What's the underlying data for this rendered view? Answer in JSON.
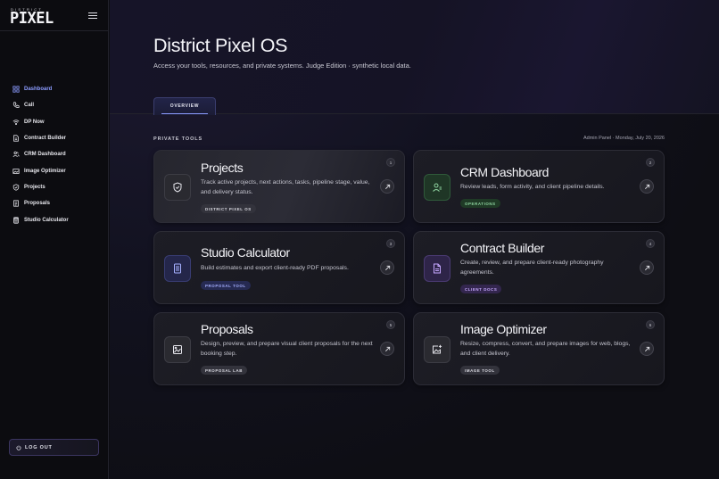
{
  "brand": {
    "small": "DISTRICT",
    "big": "PIXEL"
  },
  "nav": {
    "items": [
      {
        "label": "Dashboard",
        "icon": "grid-icon",
        "active": true
      },
      {
        "label": "Call",
        "icon": "phone-icon"
      },
      {
        "label": "DP Now",
        "icon": "wifi-icon"
      },
      {
        "label": "Contract Builder",
        "icon": "document-icon"
      },
      {
        "label": "CRM Dashboard",
        "icon": "users-icon"
      },
      {
        "label": "Image Optimizer",
        "icon": "image-icon"
      },
      {
        "label": "Projects",
        "icon": "shield-icon"
      },
      {
        "label": "Proposals",
        "icon": "file-text-icon"
      },
      {
        "label": "Studio Calculator",
        "icon": "calculator-icon"
      }
    ]
  },
  "logout_label": "LOG OUT",
  "header": {
    "title": "District Pixel OS",
    "subtitle": "Access your tools, resources, and private systems. Judge Edition · synthetic local data."
  },
  "tabs": [
    {
      "label": "OVERVIEW",
      "active": true
    }
  ],
  "section": {
    "label": "PRIVATE TOOLS",
    "meta": "Admin Panel · Monday, July 20, 2026"
  },
  "cards": [
    {
      "title": "Projects",
      "description": "Track active projects, next actions, tasks, pipeline stage, value, and delivery status.",
      "badge": "DISTRICT PIXEL OS",
      "number": "1",
      "icon": "shield-icon"
    },
    {
      "title": "CRM Dashboard",
      "description": "Review leads, form activity, and client pipeline details.",
      "badge": "OPERATIONS",
      "number": "2",
      "icon": "user-check-icon"
    },
    {
      "title": "Studio Calculator",
      "description": "Build estimates and export client-ready PDF proposals.",
      "badge": "PROPOSAL TOOL",
      "number": "3",
      "icon": "calculator-icon"
    },
    {
      "title": "Contract Builder",
      "description": "Create, review, and prepare client-ready photography agreements.",
      "badge": "CLIENT DOCS",
      "number": "4",
      "icon": "document-icon"
    },
    {
      "title": "Proposals",
      "description": "Design, preview, and prepare visual client proposals for the next booking step.",
      "badge": "PROPOSAL LAB",
      "number": "5",
      "icon": "image-frame-icon"
    },
    {
      "title": "Image Optimizer",
      "description": "Resize, compress, convert, and prepare images for web, blogs, and client delivery.",
      "badge": "IMAGE TOOL",
      "number": "6",
      "icon": "image-plus-icon"
    }
  ],
  "colors": {
    "accent": "#8c9cff",
    "badge_green": "#8fd4a0",
    "badge_purple": "#c6a8ff"
  }
}
